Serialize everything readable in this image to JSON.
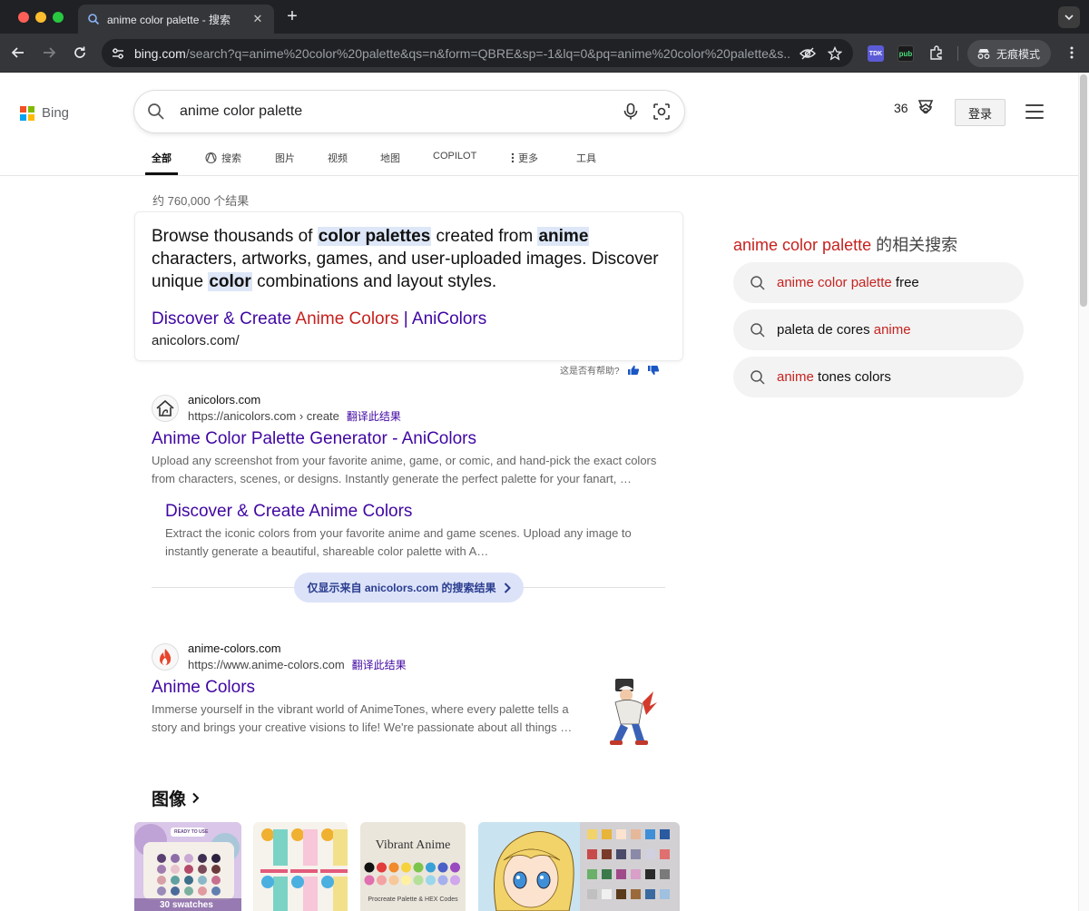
{
  "browser": {
    "tab_title": "anime color palette - 搜索",
    "url_host": "bing.com",
    "url_rest": "/search?q=anime%20color%20palette&qs=n&form=QBRE&sp=-1&lq=0&pq=anime%20color%20palette&s...",
    "ext_tdk": "TDK",
    "ext_pub": "pub",
    "incognito_label": "无痕模式"
  },
  "header": {
    "logo_text": "Bing",
    "query": "anime color palette",
    "points": "36",
    "signin_label": "登录"
  },
  "nav": {
    "tabs": [
      {
        "label": "全部"
      },
      {
        "label": "搜索"
      },
      {
        "label": "图片"
      },
      {
        "label": "视频"
      },
      {
        "label": "地图"
      },
      {
        "label": "COPILOT"
      },
      {
        "label": "更多"
      },
      {
        "label": "工具"
      }
    ]
  },
  "results_count": "约 760,000 个结果",
  "answer": {
    "t1": "Browse thousands of ",
    "h1": "color palettes",
    "t2": " created from ",
    "h2": "anime",
    "t3": " characters, artworks, games, and user-uploaded images. Discover unique ",
    "h3": "color",
    "t4": " combinations and layout styles.",
    "link_a": "Discover & Create ",
    "link_b": "Anime Colors",
    "link_c": " | AniColors",
    "url": "anicolors.com/",
    "helpful": "这是否有帮助?"
  },
  "results": [
    {
      "site": "anicolors.com",
      "path": "https://anicolors.com › create",
      "translate": "翻译此结果",
      "title": "Anime Color Palette Generator - AniColors",
      "snippet": "Upload any screenshot from your favorite anime, game, or comic, and hand-pick the exact colors from characters, scenes, or designs. Instantly generate the perfect palette for your fanart, …",
      "sublink_title": "Discover & Create Anime Colors",
      "sublink_snippet": "Extract the iconic colors from your favorite anime and game scenes. Upload any image to instantly generate a beautiful, shareable color palette with A…",
      "site_pill": "仅显示来自 anicolors.com 的搜索结果"
    },
    {
      "site": "anime-colors.com",
      "path": "https://www.anime-colors.com",
      "translate": "翻译此结果",
      "title": "Anime Colors",
      "snippet": "Immerse yourself in the vibrant world of AnimeTones, where every palette tells a story and brings your creative visions to life! We're passionate about all things …"
    }
  ],
  "images": {
    "heading": "图像",
    "thumb1_label": "30 swatches",
    "thumb1_badge": "READY TO USE",
    "thumb3_title": "Vibrant Anime",
    "thumb3_sub": "Procreate Palette & HEX Codes"
  },
  "related": {
    "title_a": "anime color palette",
    "title_b": " 的相关搜索",
    "items": [
      {
        "a": "anime color palette",
        "b": " free",
        "c": ""
      },
      {
        "a": "",
        "b": "paleta de cores ",
        "c": "anime"
      },
      {
        "a": "anime",
        "b": " tones colors",
        "c": ""
      }
    ]
  },
  "colors": {
    "link": "#4007a2",
    "highlight_red": "#c5221f",
    "pill_bg": "#dce3f9"
  }
}
